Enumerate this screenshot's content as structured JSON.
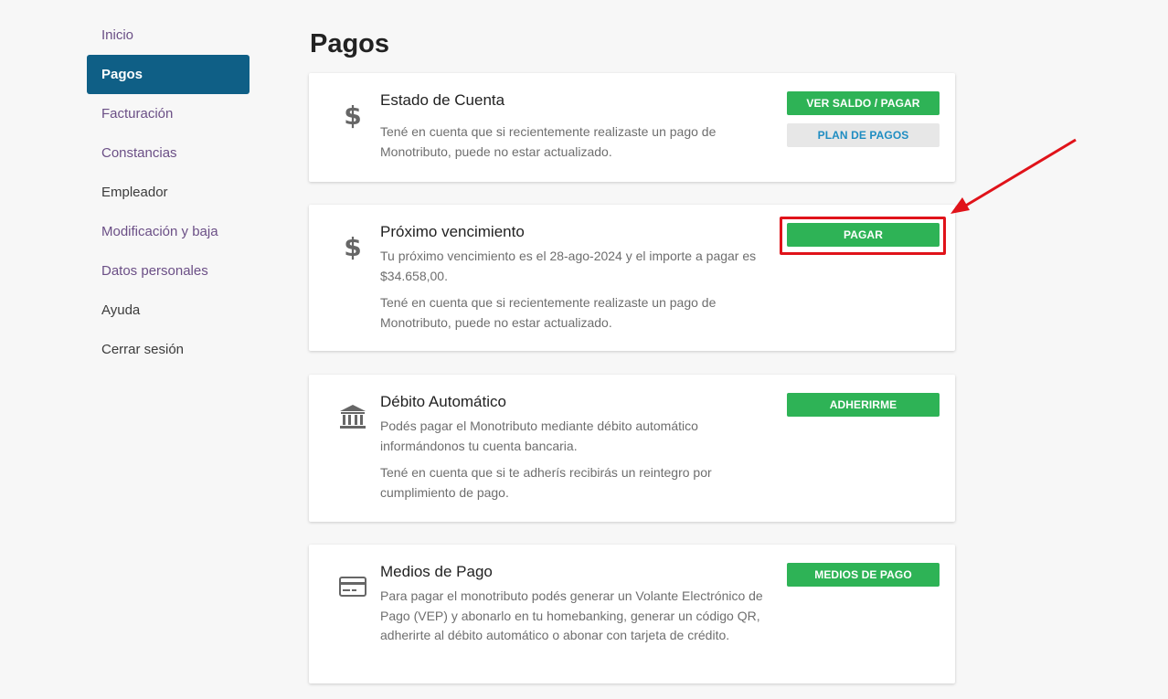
{
  "sidebar": {
    "items": [
      {
        "label": "Inicio"
      },
      {
        "label": "Pagos"
      },
      {
        "label": "Facturación"
      },
      {
        "label": "Constancias"
      },
      {
        "label": "Empleador"
      },
      {
        "label": "Modificación y baja"
      },
      {
        "label": "Datos personales"
      },
      {
        "label": "Ayuda"
      },
      {
        "label": "Cerrar sesión"
      }
    ],
    "active_index": 1
  },
  "page": {
    "title": "Pagos"
  },
  "cards": {
    "estado": {
      "icon": "dollar-icon",
      "title": "Estado de Cuenta",
      "text": "Tené en cuenta que si recientemente realizaste un pago de Monotributo, puede no estar actualizado.",
      "primary_button": "VER SALDO / PAGAR",
      "secondary_button": "PLAN DE PAGOS"
    },
    "proximo": {
      "icon": "dollar-icon",
      "title": "Próximo vencimiento",
      "text1": "Tu próximo vencimiento es el 28-ago-2024 y el importe a pagar es $34.658,00.",
      "text2": "Tené en cuenta que si recientemente realizaste un pago de Monotributo, puede no estar actualizado.",
      "button": "PAGAR"
    },
    "debito": {
      "icon": "bank-icon",
      "title": "Débito Automático",
      "text1": "Podés pagar el Monotributo mediante débito automático informándonos tu cuenta bancaria.",
      "text2": "Tené en cuenta que si te adherís recibirás un reintegro por cumplimiento de pago.",
      "button": "ADHERIRME"
    },
    "medios": {
      "icon": "credit-card-icon",
      "title": "Medios de Pago",
      "text": "Para pagar el monotributo podés generar un Volante Electrónico de Pago (VEP) y abonarlo en tu homebanking, generar un código QR, adherirte al débito automático o abonar con tarjeta de crédito.",
      "button": "MEDIOS DE PAGO"
    }
  },
  "colors": {
    "accent": "#0f5f86",
    "button_green": "#2eb356",
    "highlight_red": "#e0131a",
    "nav_link": "#6b4f86"
  }
}
